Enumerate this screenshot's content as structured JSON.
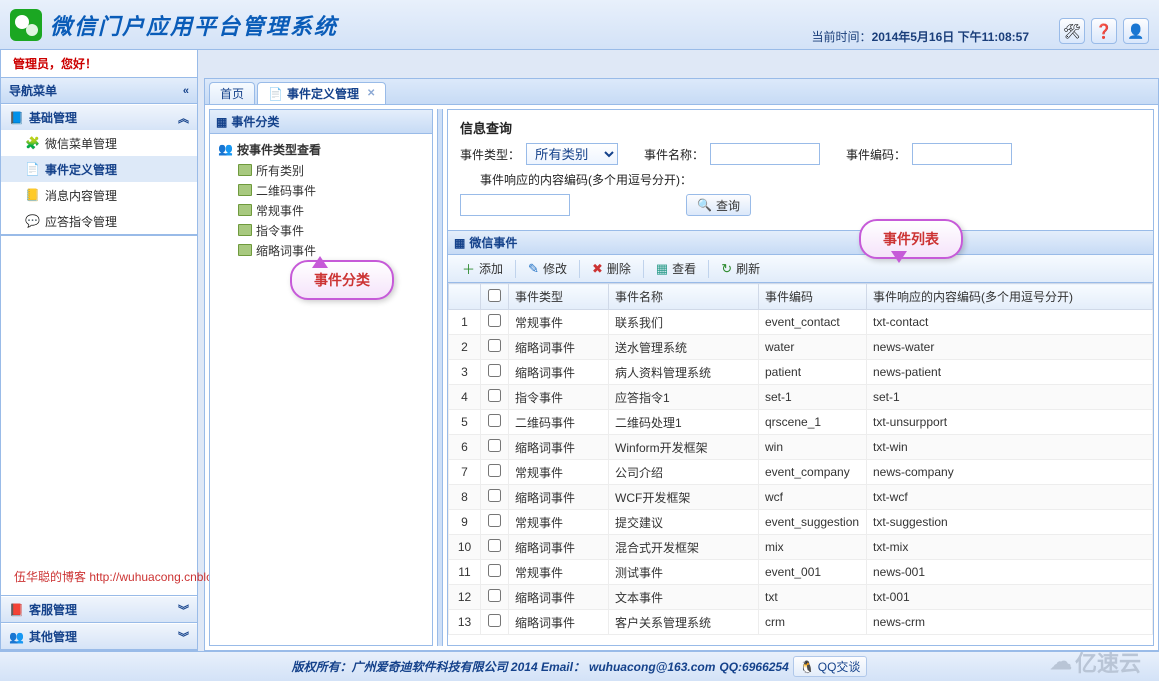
{
  "header": {
    "app_title": "微信门户应用平台管理系统",
    "clock_label": "当前时间：",
    "clock_time": "2014年5月16日 下午11:08:57",
    "btn_tools": "🛠",
    "btn_help": "❓",
    "btn_user": "👤"
  },
  "greeting": "管理员，您好！",
  "nav": {
    "title": "导航菜单",
    "groups": [
      {
        "label": "基础管理",
        "icon": "📘",
        "open": true,
        "items": [
          {
            "label": "微信菜单管理",
            "icon": "🧩"
          },
          {
            "label": "事件定义管理",
            "icon": "📄",
            "selected": true
          },
          {
            "label": "消息内容管理",
            "icon": "📒"
          },
          {
            "label": "应答指令管理",
            "icon": "💬"
          }
        ]
      },
      {
        "label": "客服管理",
        "icon": "📕",
        "open": false,
        "items": []
      },
      {
        "label": "其他管理",
        "icon": "👥",
        "open": false,
        "items": []
      }
    ]
  },
  "tabs": [
    {
      "label": "首页",
      "closable": false,
      "icon": ""
    },
    {
      "label": "事件定义管理",
      "closable": true,
      "icon": "📄",
      "active": true
    }
  ],
  "tree": {
    "panel_title": "事件分类",
    "root_label": "按事件类型查看",
    "items": [
      "所有类别",
      "二维码事件",
      "常规事件",
      "指令事件",
      "缩略词事件"
    ]
  },
  "callouts": {
    "c1": "事件分类",
    "c2": "事件列表"
  },
  "search": {
    "title": "信息查询",
    "type_label": "事件类型：",
    "type_value": "所有类别",
    "name_label": "事件名称：",
    "name_value": "",
    "code_label": "事件编码：",
    "code_value": "",
    "resp_label": "事件响应的内容编码(多个用逗号分开)：",
    "resp_value": "",
    "search_btn": "查询"
  },
  "grid": {
    "panel_title": "微信事件",
    "toolbar": [
      {
        "label": "添加",
        "cls": "green",
        "ic": "＋"
      },
      {
        "label": "修改",
        "cls": "blue",
        "ic": "✎"
      },
      {
        "label": "删除",
        "cls": "red",
        "ic": "✖"
      },
      {
        "label": "查看",
        "cls": "teal",
        "ic": "▦"
      },
      {
        "label": "刷新",
        "cls": "green",
        "ic": "↻"
      }
    ],
    "columns": [
      "",
      "事件类型",
      "事件名称",
      "事件编码",
      "事件响应的内容编码(多个用逗号分开)"
    ],
    "rows": [
      {
        "n": 1,
        "type": "常规事件",
        "name": "联系我们",
        "code": "event_contact",
        "resp": "txt-contact"
      },
      {
        "n": 2,
        "type": "缩略词事件",
        "name": "送水管理系统",
        "code": "water",
        "resp": "news-water"
      },
      {
        "n": 3,
        "type": "缩略词事件",
        "name": "病人资料管理系统",
        "code": "patient",
        "resp": "news-patient"
      },
      {
        "n": 4,
        "type": "指令事件",
        "name": "应答指令1",
        "code": "set-1",
        "resp": "set-1"
      },
      {
        "n": 5,
        "type": "二维码事件",
        "name": "二维码处理1",
        "code": "qrscene_1",
        "resp": "txt-unsurpport"
      },
      {
        "n": 6,
        "type": "缩略词事件",
        "name": "Winform开发框架",
        "code": "win",
        "resp": "txt-win"
      },
      {
        "n": 7,
        "type": "常规事件",
        "name": "公司介绍",
        "code": "event_company",
        "resp": "news-company"
      },
      {
        "n": 8,
        "type": "缩略词事件",
        "name": "WCF开发框架",
        "code": "wcf",
        "resp": "txt-wcf"
      },
      {
        "n": 9,
        "type": "常规事件",
        "name": "提交建议",
        "code": "event_suggestion",
        "resp": "txt-suggestion"
      },
      {
        "n": 10,
        "type": "缩略词事件",
        "name": "混合式开发框架",
        "code": "mix",
        "resp": "txt-mix"
      },
      {
        "n": 11,
        "type": "常规事件",
        "name": "测试事件",
        "code": "event_001",
        "resp": "news-001"
      },
      {
        "n": 12,
        "type": "缩略词事件",
        "name": "文本事件",
        "code": "txt",
        "resp": "txt-001"
      },
      {
        "n": 13,
        "type": "缩略词事件",
        "name": "客户关系管理系统",
        "code": "crm",
        "resp": "news-crm"
      }
    ]
  },
  "blog": {
    "text": "伍华聪的博客 ",
    "url": "http://wuhuacong.cnblogs.com"
  },
  "footer": {
    "copyright": "版权所有：广州爱奇迪软件科技有限公司 2014 Email：",
    "email": "wuhuacong@163.com",
    "qq_label": " QQ:6966254 ",
    "qq_btn": "QQ交谈"
  },
  "watermark": "亿速云"
}
